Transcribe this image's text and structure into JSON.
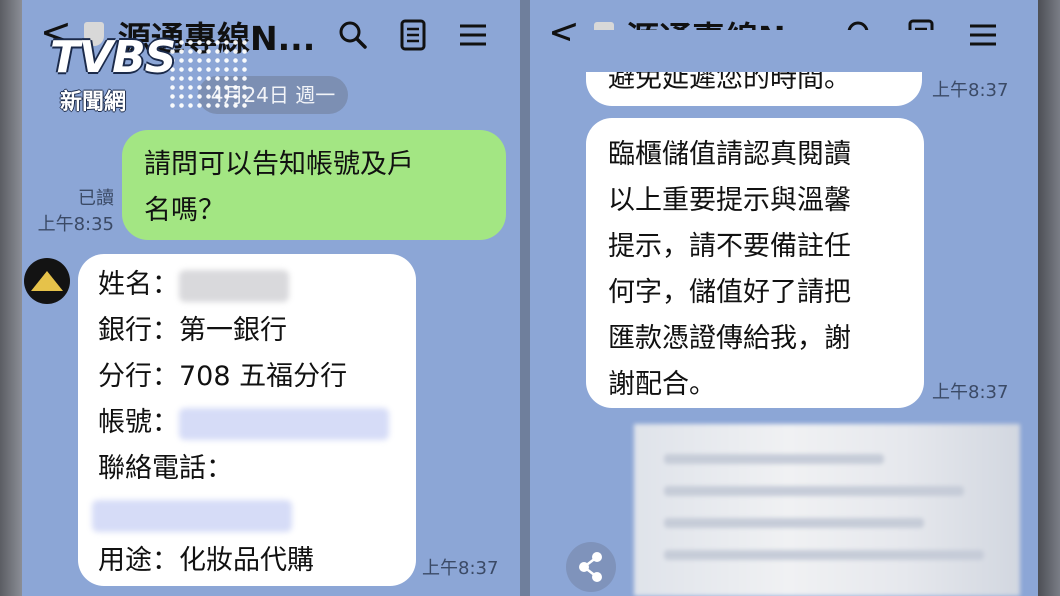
{
  "brand": {
    "logo_main": "TVBS",
    "logo_sub": "新聞網"
  },
  "left_chat": {
    "back_glyph": "<",
    "title": "源通專線N...",
    "date_pill": "4月24日 週一",
    "sent_message": {
      "lines": [
        "請問可以告知帳號及戶",
        "名嗎？"
      ],
      "read_label": "已讀",
      "time": "上午8:35"
    },
    "received_message": {
      "name_label": "姓名：",
      "bank_line": "銀行：第一銀行",
      "branch_line": "分行：708 五福分行",
      "account_label": "帳號：",
      "phone_label": "聯絡電話：",
      "purpose_line": "用途：化妝品代購",
      "time": "上午8:37"
    }
  },
  "right_chat": {
    "back_glyph": "<",
    "title": "源通專線N...",
    "cut_message": {
      "text": "避免延遲您的時間。",
      "time": "上午8:37"
    },
    "notice_message": {
      "lines": [
        "臨櫃儲值請認真閱讀",
        "以上重要提示與溫馨",
        "提示，請不要備註任",
        "何字，儲值好了請把",
        "匯款憑證傳給我，謝",
        "謝配合。"
      ],
      "time": "上午8:37"
    }
  },
  "colors": {
    "chat_background": "#8ca6d6",
    "sent_bubble": "#a3e683",
    "received_bubble": "#ffffff"
  },
  "icons": [
    "back-arrow-icon",
    "shield-icon",
    "search-icon",
    "notes-icon",
    "menu-icon",
    "share-icon"
  ]
}
